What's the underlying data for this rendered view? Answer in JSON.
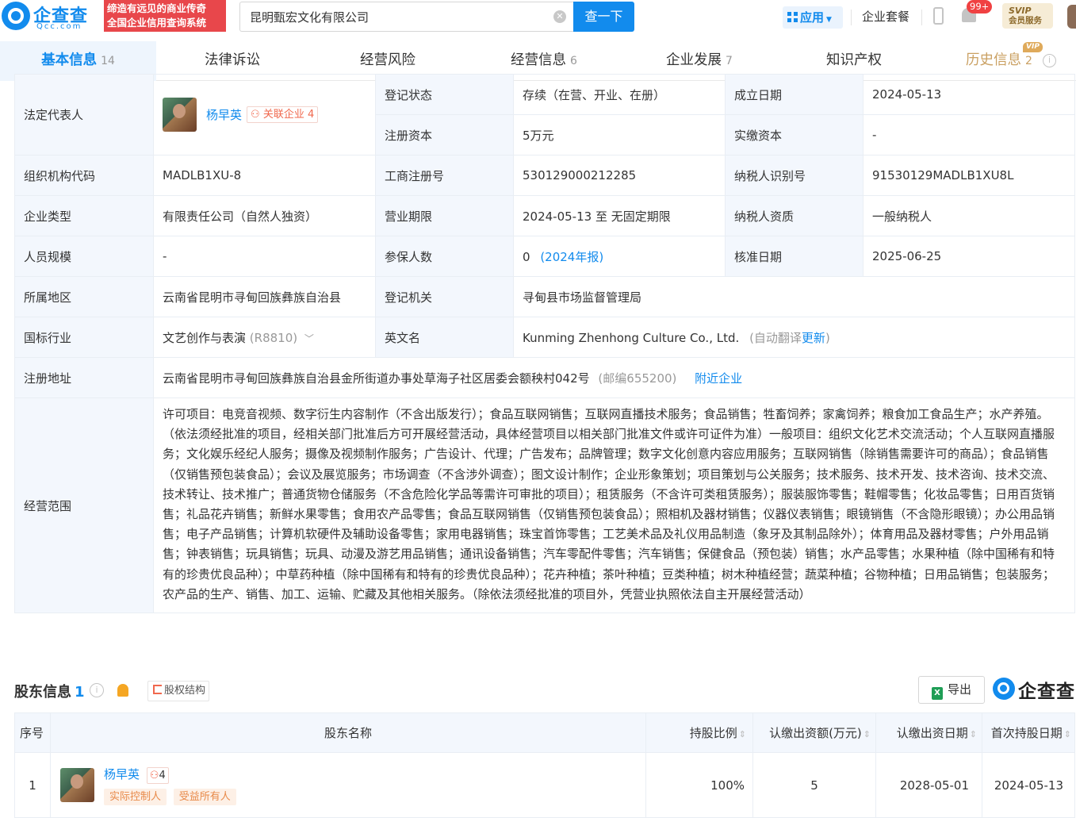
{
  "header": {
    "logo_text": "企查查",
    "logo_sub": "Qcc.com",
    "slogan_line1": "缔造有远见的商业传奇",
    "slogan_line2": "全国企业信用查询系统",
    "search_value": "昆明甄宏文化有限公司",
    "search_button": "查一下",
    "apps_label": "应用",
    "package_label": "企业套餐",
    "notification_badge": "99+",
    "svip_line1": "SVIP",
    "svip_line2": "会员服务"
  },
  "tabs": [
    {
      "label": "基本信息",
      "count": "14"
    },
    {
      "label": "法律诉讼",
      "count": ""
    },
    {
      "label": "经营风险",
      "count": ""
    },
    {
      "label": "经营信息",
      "count": "6"
    },
    {
      "label": "企业发展",
      "count": "7"
    },
    {
      "label": "知识产权",
      "count": ""
    },
    {
      "label": "历史信息",
      "count": "2"
    }
  ],
  "vip_tag": "VIP",
  "info": {
    "legal_rep_label": "法定代表人",
    "legal_rep_name": "杨早英",
    "related_label": "关联企业",
    "related_count": "4",
    "reg_status_label": "登记状态",
    "reg_status": "存续（在营、开业、在册）",
    "founded_label": "成立日期",
    "founded": "2024-05-13",
    "reg_capital_label": "注册资本",
    "reg_capital": "5万元",
    "paid_capital_label": "实缴资本",
    "paid_capital": "-",
    "org_code_label": "组织机构代码",
    "org_code": "MADLB1XU-8",
    "biz_reg_no_label": "工商注册号",
    "biz_reg_no": "530129000212285",
    "tax_id_label": "纳税人识别号",
    "tax_id": "91530129MADLB1XU8L",
    "company_type_label": "企业类型",
    "company_type": "有限责任公司（自然人独资）",
    "biz_term_label": "营业期限",
    "biz_term": "2024-05-13 至 无固定期限",
    "taxpayer_qual_label": "纳税人资质",
    "taxpayer_qual": "一般纳税人",
    "staff_size_label": "人员规模",
    "staff_size": "-",
    "insured_label": "参保人数",
    "insured": "0",
    "insured_year": "(2024年报)",
    "approved_label": "核准日期",
    "approved": "2025-06-25",
    "region_label": "所属地区",
    "region": "云南省昆明市寻甸回族彝族自治县",
    "authority_label": "登记机关",
    "authority": "寻甸县市场监督管理局",
    "industry_label": "国标行业",
    "industry": "文艺创作与表演",
    "industry_code": "(R8810)",
    "english_name_label": "英文名",
    "english_name": "Kunming Zhenhong Culture Co., Ltd.",
    "english_name_note_prefix": "(自动翻译",
    "english_name_update": "更新",
    "english_name_note_suffix": ")",
    "address_label": "注册地址",
    "address": "云南省昆明市寻甸回族彝族自治县金所街道办事处草海子社区居委会额秧村042号",
    "postcode": "(邮编655200)",
    "nearby_link": "附近企业",
    "scope_label": "经营范围",
    "scope": "许可项目：电竞音视频、数字衍生内容制作（不含出版发行）；食品互联网销售；互联网直播技术服务；食品销售；牲畜饲养；家禽饲养；粮食加工食品生产；水产养殖。（依法须经批准的项目，经相关部门批准后方可开展经营活动，具体经营项目以相关部门批准文件或许可证件为准）一般项目：组织文化艺术交流活动；个人互联网直播服务；文化娱乐经纪人服务；摄像及视频制作服务；广告设计、代理；广告发布；品牌管理；数字文化创意内容应用服务；互联网销售（除销售需要许可的商品）；食品销售（仅销售预包装食品）；会议及展览服务；市场调查（不含涉外调查）；图文设计制作；企业形象策划；项目策划与公关服务；技术服务、技术开发、技术咨询、技术交流、技术转让、技术推广；普通货物仓储服务（不含危险化学品等需许可审批的项目）；租赁服务（不含许可类租赁服务）；服装服饰零售；鞋帽零售；化妆品零售；日用百货销售；礼品花卉销售；新鲜水果零售；食用农产品零售；食品互联网销售（仅销售预包装食品）；照相机及器材销售；仪器仪表销售；眼镜销售（不含隐形眼镜）；办公用品销售；电子产品销售；计算机软硬件及辅助设备零售；家用电器销售；珠宝首饰零售；工艺美术品及礼仪用品制造（象牙及其制品除外）；体育用品及器材零售；户外用品销售；钟表销售；玩具销售；玩具、动漫及游艺用品销售；通讯设备销售；汽车零配件零售；汽车销售；保健食品（预包装）销售；水产品零售；水果种植（除中国稀有和特有的珍贵优良品种）；中草药种植（除中国稀有和特有的珍贵优良品种）；花卉种植；茶叶种植；豆类种植；树木种植经营；蔬菜种植；谷物种植；日用品销售；包装服务；农产品的生产、销售、加工、运输、贮藏及其他相关服务。（除依法须经批准的项目外，凭营业执照依法自主开展经营活动）"
  },
  "shareholders": {
    "title": "股东信息",
    "count": "1",
    "equity_button": "股权结构",
    "export_button": "导出",
    "logo_text": "企查查",
    "columns": [
      "序号",
      "股东名称",
      "持股比例",
      "认缴出资额(万元)",
      "认缴出资日期",
      "首次持股日期"
    ],
    "rows": [
      {
        "index": "1",
        "name": "杨早英",
        "related_count": "4",
        "tags": [
          "实际控制人",
          "受益所有人"
        ],
        "ratio": "100%",
        "subscribed": "5",
        "subscribed_date": "2028-05-01",
        "first_date": "2024-05-13"
      }
    ]
  },
  "colors": {
    "brand_blue": "#128bed",
    "label_bg": "#f3f7fd",
    "slogan_red": "#e8474b",
    "vip_gold": "#caa062"
  }
}
